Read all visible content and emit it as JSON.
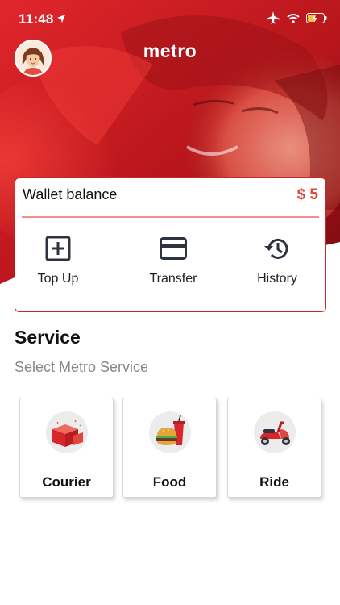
{
  "status_bar": {
    "time": "11:48",
    "icons": [
      "location-arrow-icon",
      "airplane-icon",
      "wifi-icon",
      "battery-charging-icon"
    ]
  },
  "header": {
    "app_title": "metro",
    "avatar_icon": "user-avatar"
  },
  "wallet": {
    "label": "Wallet balance",
    "amount": "$ 5",
    "actions": [
      {
        "label": "Top Up",
        "icon": "plus-square-icon"
      },
      {
        "label": "Transfer",
        "icon": "credit-card-icon"
      },
      {
        "label": "History",
        "icon": "history-icon"
      }
    ]
  },
  "service": {
    "title": "Service",
    "subtitle": "Select Metro Service",
    "items": [
      {
        "label": "Courier",
        "icon": "courier-package-icon"
      },
      {
        "label": "Food",
        "icon": "burger-drink-icon"
      },
      {
        "label": "Ride",
        "icon": "scooter-icon"
      }
    ]
  },
  "colors": {
    "brand_red": "#d81f26",
    "accent_red": "#e0473f",
    "divider_pink": "#f28f8a"
  }
}
